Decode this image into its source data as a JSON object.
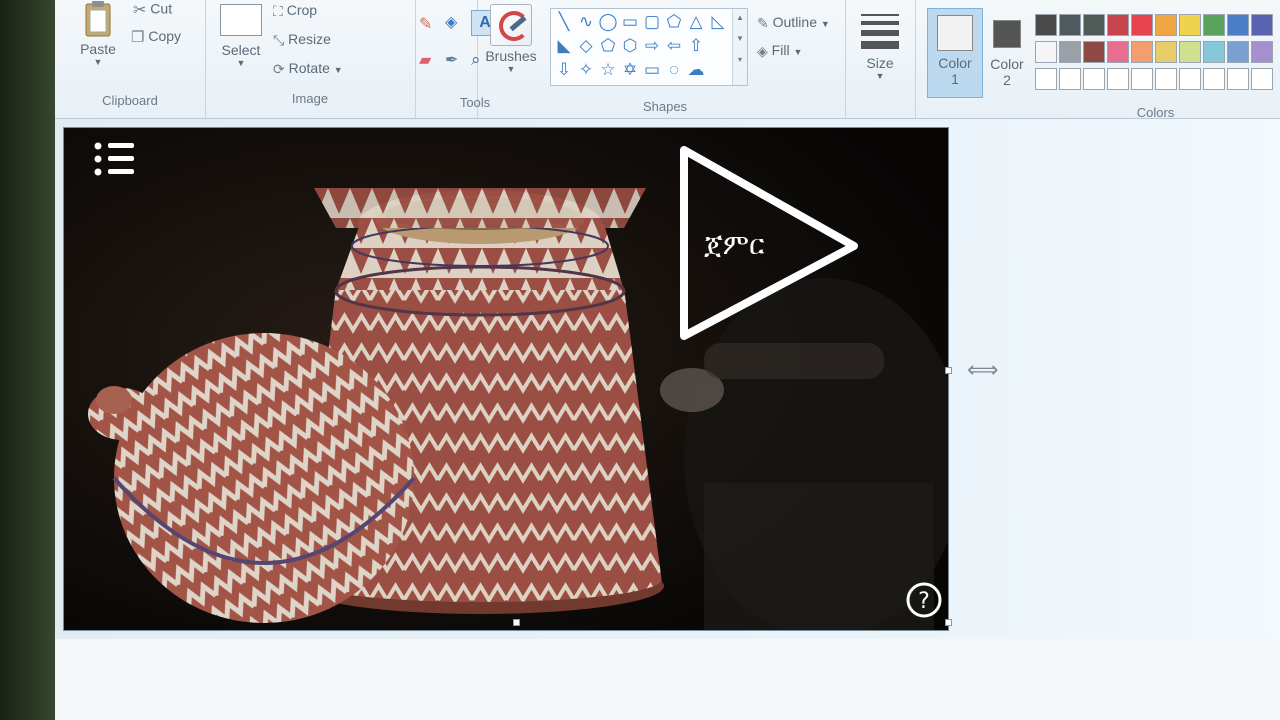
{
  "ribbon": {
    "clipboard": {
      "group_label": "Clipboard",
      "paste": "Paste",
      "cut": "Cut",
      "copy": "Copy"
    },
    "image": {
      "group_label": "Image",
      "select": "Select",
      "crop": "Crop",
      "resize": "Resize",
      "rotate": "Rotate"
    },
    "tools": {
      "group_label": "Tools"
    },
    "brushes": {
      "label": "Brushes"
    },
    "shapes": {
      "group_label": "Shapes",
      "outline": "Outline",
      "fill": "Fill"
    },
    "size": {
      "label": "Size"
    },
    "color1": {
      "label_a": "Color",
      "label_b": "1"
    },
    "color2": {
      "label_a": "Color",
      "label_b": "2"
    },
    "colors": {
      "group_label": "Colors",
      "row1": [
        "#4a4a4a",
        "#505a5e",
        "#4f5b57",
        "#c8444c",
        "#e5434d",
        "#f1a646",
        "#f0d34c",
        "#5aa35c",
        "#4a7fc7",
        "#5b62b0"
      ],
      "row2": [
        "#f5f5f5",
        "#9aa0a6",
        "#8e4a42",
        "#e76e8e",
        "#f39e6e",
        "#e6cd6a",
        "#cfe08e",
        "#86c8d8",
        "#79a0cf",
        "#a58fcc"
      ],
      "row3": [
        "#ffffff",
        "#ffffff",
        "#ffffff",
        "#ffffff",
        "#ffffff",
        "#ffffff",
        "#ffffff",
        "#ffffff",
        "#ffffff",
        "#ffffff"
      ]
    },
    "color1_swatch": "#f2f2f2",
    "color2_swatch": "#555555"
  },
  "picture": {
    "overlay_word": "ጀምር",
    "help_glyph": "?"
  }
}
